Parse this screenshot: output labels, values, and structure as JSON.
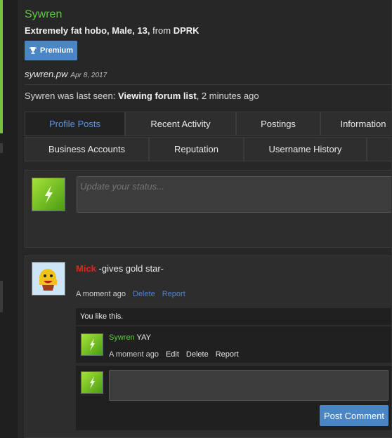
{
  "profile": {
    "username": "Sywren",
    "blurb_prefix": "Extremely fat hobo, Male, 13,",
    "blurb_from": "from",
    "blurb_location": "DPRK",
    "badge_label": "Premium",
    "site": "sywren.pw",
    "site_date": "Apr 8, 2017",
    "last_seen_prefix": "Sywren was last seen:",
    "last_seen_activity": "Viewing forum list",
    "last_seen_time": ", 2 minutes ago"
  },
  "tabs": {
    "row1": [
      "Profile Posts",
      "Recent Activity",
      "Postings",
      "Information"
    ],
    "row2": [
      "Business Accounts",
      "Reputation",
      "Username History"
    ]
  },
  "status": {
    "placeholder": "Update your status..."
  },
  "post": {
    "author": "Mick",
    "text": " -gives gold star-",
    "time": "A moment ago",
    "delete": "Delete",
    "report": "Report",
    "likes": "You like this.",
    "comment": {
      "author": "Sywren",
      "text": " YAY",
      "time": "A moment ago",
      "edit": "Edit",
      "delete": "Delete",
      "report": "Report"
    },
    "post_comment_label": "Post Comment"
  },
  "colors": {
    "accent_green": "#5ec845",
    "link_blue": "#4e86c9",
    "button_blue": "#4a86c5",
    "author_red": "#e0241c"
  }
}
